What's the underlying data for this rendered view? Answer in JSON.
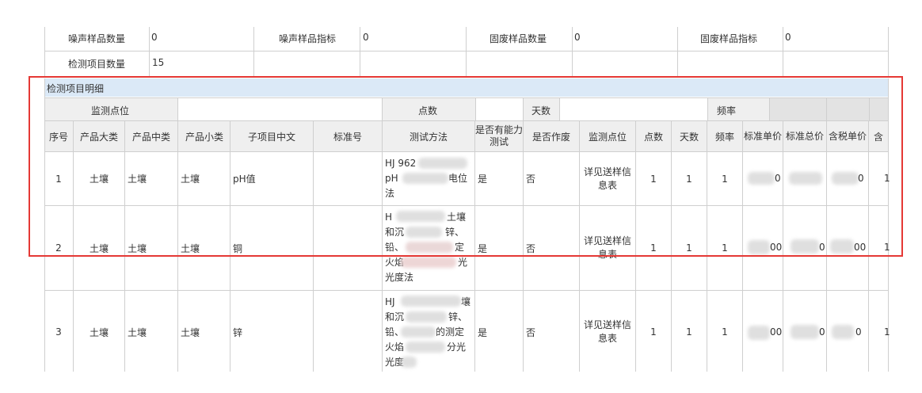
{
  "summary": {
    "row1": [
      {
        "label": "噪声样品数量",
        "value": "0"
      },
      {
        "label": "噪声样品指标",
        "value": "0"
      },
      {
        "label": "固废样品数量",
        "value": "0"
      },
      {
        "label": "固废样品指标",
        "value": "0"
      }
    ],
    "row2": {
      "label": "检测项目数量",
      "value": "15"
    }
  },
  "section_title": "检测项目明细",
  "subheader": {
    "monitor_point": "监测点位",
    "points": "点数",
    "days": "天数",
    "frequency": "频率"
  },
  "columns": [
    "序号",
    "产品大类",
    "产品中类",
    "产品小类",
    "子项目中文",
    "标准号",
    "测试方法",
    "是否有能力测试",
    "是否作废",
    "监测点位",
    "点数",
    "天数",
    "频率",
    "标准单价",
    "标准总价",
    "含税单价",
    "含"
  ],
  "rows": [
    {
      "no": "1",
      "cat": "土壤",
      "mid": "土壤",
      "small": "土壤",
      "item": "pH值",
      "std": "",
      "method": [
        "HJ 962",
        "pH",
        "法"
      ],
      "method_tail": "电位",
      "capable": "是",
      "void": "否",
      "point": "详见送样信息表",
      "points": "1",
      "days": "1",
      "freq": "1",
      "unit": "0",
      "total": "",
      "tax": "0",
      "last": "1"
    },
    {
      "no": "2",
      "cat": "土壤",
      "mid": "土壤",
      "small": "土壤",
      "item": "铜",
      "std": "",
      "method": [
        "H",
        "和沉",
        "铅、",
        "火焰",
        "光度法"
      ],
      "method_tail": "土壤",
      "method_tail2": "锌、",
      "method_tail3": "定",
      "method_tail4": "光",
      "capable": "是",
      "void": "否",
      "point": "详见送样信息表",
      "points": "1",
      "days": "1",
      "freq": "1",
      "unit": "00",
      "total": "0",
      "tax": "00",
      "last": "1"
    },
    {
      "no": "3",
      "cat": "土壤",
      "mid": "土壤",
      "small": "土壤",
      "item": "锌",
      "std": "",
      "method": [
        "HJ",
        "和沉",
        "铅、",
        "火焰",
        "光度"
      ],
      "method_tail": "壤",
      "method_tail2": "锌、",
      "method_tail3": "的测定",
      "method_tail4": "分光",
      "capable": "是",
      "void": "否",
      "point": "详见送样信息表",
      "points": "1",
      "days": "1",
      "freq": "1",
      "unit": "00",
      "total": "0",
      "tax": "0",
      "last": "1"
    }
  ],
  "colors": {
    "band": "#dbe9f7",
    "highlight_border": "#e53935",
    "grid": "#cfcfcf"
  }
}
